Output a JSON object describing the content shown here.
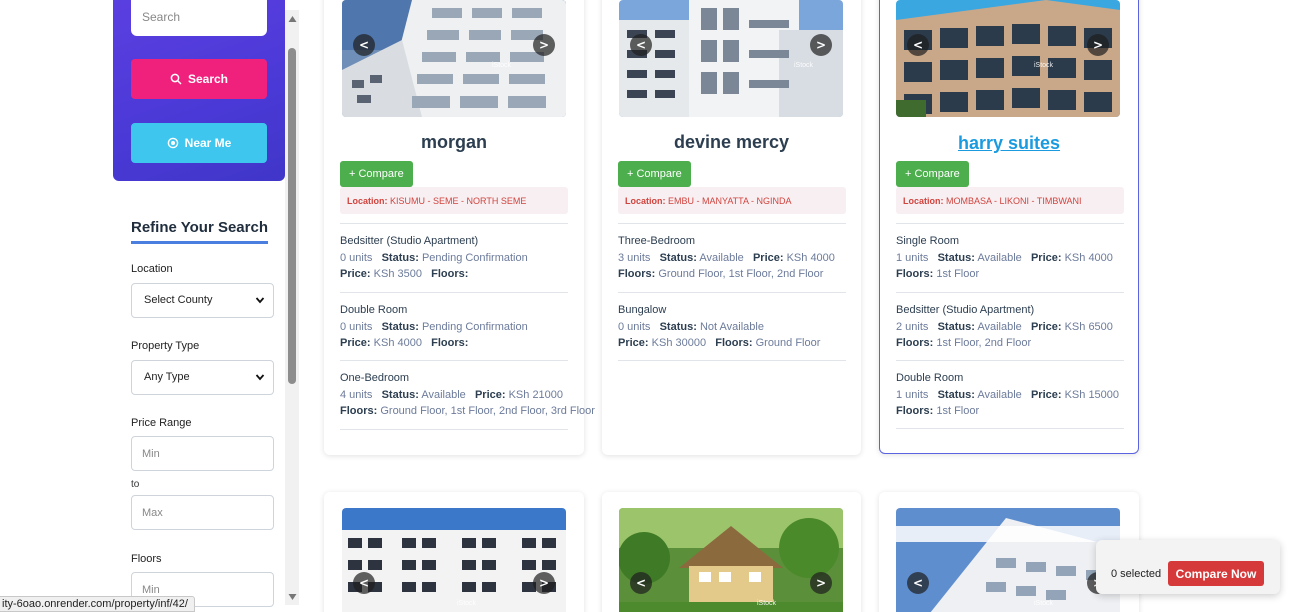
{
  "sidebar": {
    "search_placeholder": "Search",
    "search_button": "Search",
    "near_me_button": "Near Me",
    "refine_title": "Refine Your Search",
    "location_label": "Location",
    "location_value": "Select County",
    "property_type_label": "Property Type",
    "property_type_value": "Any Type",
    "price_range_label": "Price Range",
    "min_placeholder": "Min",
    "to_label": "to",
    "max_placeholder": "Max",
    "floors_label": "Floors",
    "floors_min_placeholder": "Min"
  },
  "status_url": "ity-6oao.onrender.com/property/inf/42/",
  "watermark": "iStock",
  "cards": [
    {
      "title": "morgan",
      "compare_label": "+ Compare",
      "location_label": "Location:",
      "location": "KISUMU - SEME - NORTH SEME",
      "rooms": [
        {
          "name": "Bedsitter (Studio Apartment)",
          "units": "0 units",
          "status_label": "Status:",
          "status": "Pending Confirmation",
          "price_label": "Price:",
          "price": "KSh 3500",
          "floors_label": "Floors:",
          "floors": ""
        },
        {
          "name": "Double Room",
          "units": "0 units",
          "status_label": "Status:",
          "status": "Pending Confirmation",
          "price_label": "Price:",
          "price": "KSh 4000",
          "floors_label": "Floors:",
          "floors": ""
        },
        {
          "name": "One-Bedroom",
          "units": "4 units",
          "status_label": "Status:",
          "status": "Available",
          "price_label": "Price:",
          "price": "KSh 21000",
          "floors_label": "Floors:",
          "floors": "Ground Floor, 1st Floor, 2nd Floor, 3rd Floor"
        }
      ]
    },
    {
      "title": "devine mercy",
      "compare_label": "+ Compare",
      "location_label": "Location:",
      "location": "EMBU - MANYATTA - NGINDA",
      "rooms": [
        {
          "name": "Three-Bedroom",
          "units": "3 units",
          "status_label": "Status:",
          "status": "Available",
          "price_label": "Price:",
          "price": "KSh 4000",
          "floors_label": "Floors:",
          "floors": "Ground Floor, 1st Floor, 2nd Floor"
        },
        {
          "name": "Bungalow",
          "units": "0 units",
          "status_label": "Status:",
          "status": "Not Available",
          "price_label": "Price:",
          "price": "KSh 30000",
          "floors_label": "Floors:",
          "floors": "Ground Floor"
        }
      ]
    },
    {
      "title": "harry suites",
      "compare_label": "+ Compare",
      "location_label": "Location:",
      "location": "MOMBASA - LIKONI - TIMBWANI",
      "rooms": [
        {
          "name": "Single Room",
          "units": "1 units",
          "status_label": "Status:",
          "status": "Available",
          "price_label": "Price:",
          "price": "KSh 4000",
          "floors_label": "Floors:",
          "floors": "1st Floor"
        },
        {
          "name": "Bedsitter (Studio Apartment)",
          "units": "2 units",
          "status_label": "Status:",
          "status": "Available",
          "price_label": "Price:",
          "price": "KSh 6500",
          "floors_label": "Floors:",
          "floors": "1st Floor, 2nd Floor"
        },
        {
          "name": "Double Room",
          "units": "1 units",
          "status_label": "Status:",
          "status": "Available",
          "price_label": "Price:",
          "price": "KSh 15000",
          "floors_label": "Floors:",
          "floors": "1st Floor"
        }
      ]
    }
  ],
  "compare_widget": {
    "selected_text": "0 selected",
    "button": "Compare Now"
  },
  "colors": {
    "search_panel": "#4a39d6",
    "search_button": "#f0217c",
    "near_me_button": "#3fc6ee",
    "compare_button": "#4cae4c",
    "compare_now": "#d63939",
    "link": "#1a9be0"
  }
}
